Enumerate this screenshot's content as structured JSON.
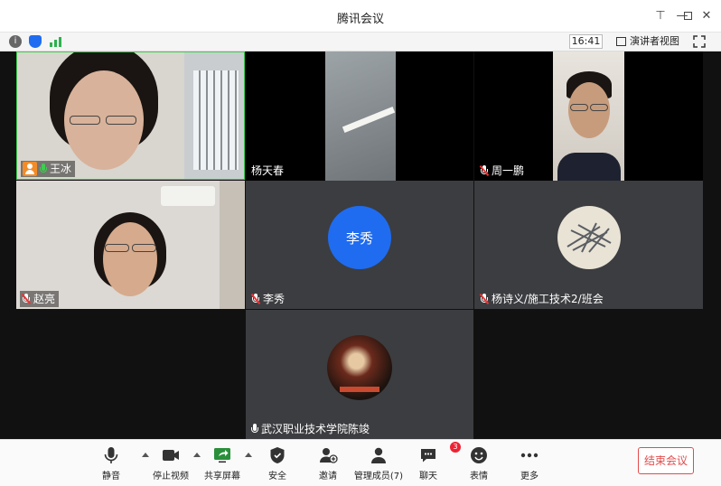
{
  "window": {
    "title": "腾讯会议"
  },
  "infobar": {
    "time": "16:41",
    "presenter_view": "演讲者视图"
  },
  "participants": [
    {
      "name": "王冰",
      "mic": "on",
      "host": true
    },
    {
      "name": "杨天春",
      "mic": "none"
    },
    {
      "name": "周一鹏",
      "mic": "muted"
    },
    {
      "name": "赵亮",
      "mic": "muted"
    },
    {
      "name": "李秀",
      "mic": "muted",
      "avatar_text": "李秀"
    },
    {
      "name": "杨诗义/施工技术2/班会",
      "mic": "muted"
    },
    {
      "name": "武汉职业技术学院陈竣",
      "mic": "on-white"
    }
  ],
  "toolbar": {
    "mute": "静音",
    "stop_video": "停止视频",
    "share_screen": "共享屏幕",
    "security": "安全",
    "invite": "邀请",
    "members": "管理成员(7)",
    "chat": "聊天",
    "chat_badge": "3",
    "reactions": "表情",
    "more": "更多",
    "end_meeting": "结束会议"
  },
  "colors": {
    "avatar_blue": "#1f6cf0",
    "end_red": "#e24b4b",
    "active_speaker": "#3ccf4e"
  }
}
